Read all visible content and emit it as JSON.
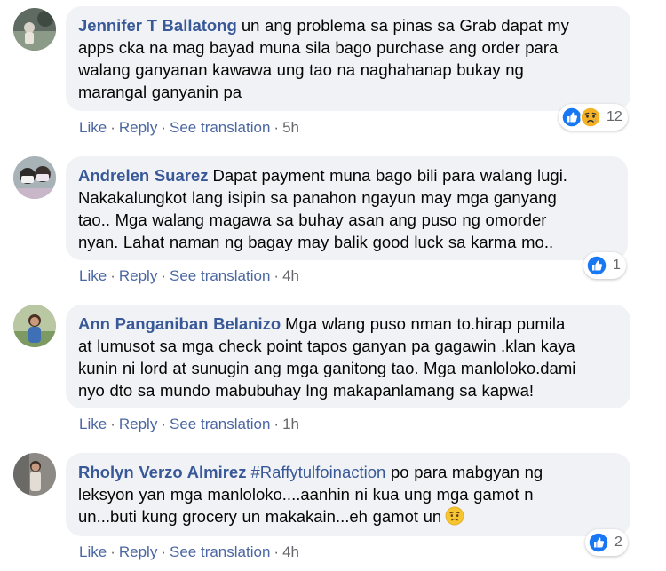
{
  "comments": [
    {
      "author": "Jennifer T Ballatong",
      "lines": [
        "un ang problema sa pinas sa Grab dapat my",
        "apps cka na mag bayad muna sila bago purchase ang order para",
        "walang ganyanan kawawa ung tao na naghahanap bukay ng",
        "marangal ganyanin pa"
      ],
      "actions": {
        "like": "Like",
        "reply": "Reply",
        "translate": "See translation",
        "time": "5h"
      },
      "reactions": {
        "icons": [
          "like-reaction-icon",
          "sad-reaction-icon"
        ],
        "count": "12"
      }
    },
    {
      "author": "Andrelen Suarez",
      "lines": [
        "Dapat payment muna bago bili para walang lugi.",
        "Nakakalungkot lang isipin sa panahon ngayun may mga ganyang",
        "tao.. Mga walang magawa sa buhay asan ang puso ng omorder",
        "nyan. Lahat naman ng bagay may balik good luck sa karma mo.."
      ],
      "actions": {
        "like": "Like",
        "reply": "Reply",
        "translate": "See translation",
        "time": "4h"
      },
      "reactions": {
        "icons": [
          "like-reaction-icon"
        ],
        "count": "1"
      }
    },
    {
      "author": "Ann Panganiban Belanizo",
      "lines": [
        "Mga wlang puso nman to.hirap pumila",
        "at lumusot sa mga check point tapos ganyan pa gagawin .klan kaya",
        "kunin ni lord at sunugin ang mga ganitong tao. Mga manloloko.dami",
        "nyo dto sa mundo mabubuhay lng makapanlamang sa kapwa!"
      ],
      "actions": {
        "like": "Like",
        "reply": "Reply",
        "translate": "See translation",
        "time": "1h"
      }
    },
    {
      "author": "Rholyn Verzo Almirez",
      "hashtag": "#Raffytulfoinaction",
      "lines": [
        "po para mabgyan ng",
        "leksyon yan mga manloloko....aanhin ni kua ung mga gamot n",
        "un...buti kung grocery un makakain...eh gamot un"
      ],
      "trailing_emoji": "disappointed-face-icon",
      "actions": {
        "like": "Like",
        "reply": "Reply",
        "translate": "See translation",
        "time": "4h"
      },
      "reactions": {
        "icons": [
          "like-reaction-icon"
        ],
        "count": "2"
      }
    }
  ],
  "colors": {
    "author": "#385898",
    "bubble": "#f0f2f5",
    "action_link": "#4b67a1",
    "meta": "#65676b",
    "like_blue": "#1877f2",
    "sad_yellow": "#f7b125"
  }
}
